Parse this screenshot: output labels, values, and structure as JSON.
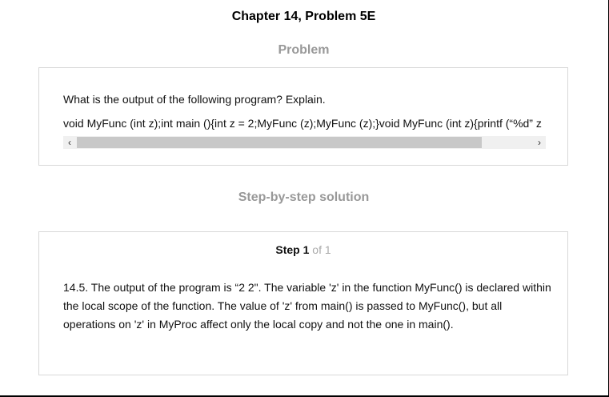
{
  "chapter_title": "Chapter 14, Problem 5E",
  "problem": {
    "heading": "Problem",
    "question": "What is the output of the following program? Explain.",
    "code": "void MyFunc (int z);int main (){int z = 2;MyFunc (z);MyFunc (z);}void MyFunc (int z){printf (“%d” z",
    "scrollbar": {
      "left_arrow": "‹",
      "right_arrow": "›",
      "thumb_fraction": 0.89
    }
  },
  "solution": {
    "heading": "Step-by-step solution",
    "step_word": "Step",
    "step_number": "1",
    "step_of": "of 1",
    "text": "14.5. The output of the program is “2 2\". The variable 'z' in the function MyFunc() is declared within the local scope of the function. The value of 'z' from main() is passed to MyFunc(), but all operations on 'z' in MyProc affect only the local copy and not the one in main()."
  }
}
